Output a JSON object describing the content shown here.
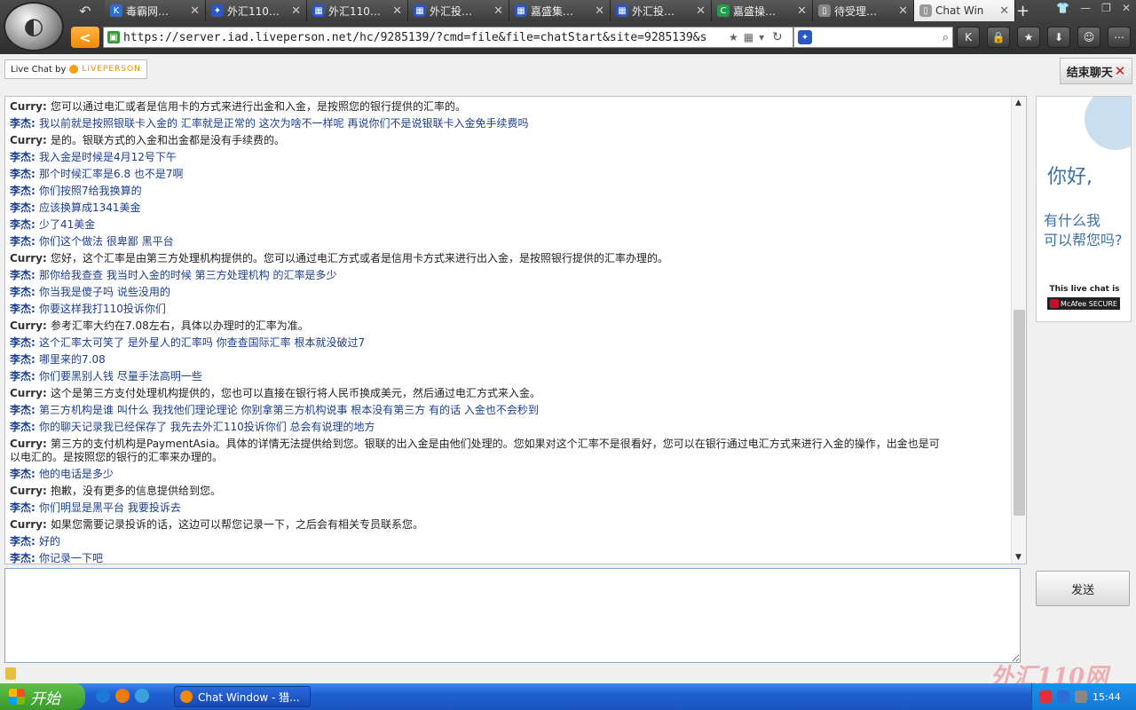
{
  "browser": {
    "tabs": [
      {
        "title": "毒霸网…",
        "icon_color": "#2b6fd6",
        "icon_glyph": "K",
        "active": false
      },
      {
        "title": "外汇110…",
        "icon_color": "#2b56c4",
        "icon_glyph": "✦",
        "active": false
      },
      {
        "title": "外汇110…",
        "icon_color": "#2b56c4",
        "icon_glyph": "▦",
        "active": false
      },
      {
        "title": "外汇投…",
        "icon_color": "#2b56c4",
        "icon_glyph": "▦",
        "active": false
      },
      {
        "title": "嘉盛集…",
        "icon_color": "#2b56c4",
        "icon_glyph": "▦",
        "active": false
      },
      {
        "title": "外汇投…",
        "icon_color": "#2b56c4",
        "icon_glyph": "▦",
        "active": false
      },
      {
        "title": "嘉盛操…",
        "icon_color": "#1e9e4a",
        "icon_glyph": "C",
        "active": false
      },
      {
        "title": "待受理…",
        "icon_color": "#888888",
        "icon_glyph": "▯",
        "active": false
      },
      {
        "title": "Chat Win",
        "icon_color": "#999999",
        "icon_glyph": "▯",
        "active": true
      }
    ],
    "url": "https://server.iad.liveperson.net/hc/9285139/?cmd=file&file=chatStart&site=9285139&s"
  },
  "page": {
    "logo_prefix": "Live Chat by",
    "logo_brand": "LIVEPERSON",
    "end_chat_label": "结束聊天",
    "send_label": "发送",
    "ad": {
      "hello": "你好,",
      "help_line1": "有什么我",
      "help_line2": "可以帮您吗?",
      "secure_text": "This live chat is",
      "mcafee_text": "McAfee SECURE"
    }
  },
  "messages": [
    {
      "who": "Curry",
      "role": "agent",
      "text": "您可以通过电汇或者是信用卡的方式来进行出金和入金，是按照您的银行提供的汇率的。"
    },
    {
      "who": "李杰",
      "role": "visitor",
      "text": "我以前就是按照银联卡入金的 汇率就是正常的 这次为啥不一样呢 再说你们不是说银联卡入金免手续费吗"
    },
    {
      "who": "Curry",
      "role": "agent",
      "text": "是的。银联方式的入金和出金都是没有手续费的。"
    },
    {
      "who": "李杰",
      "role": "visitor",
      "text": "我入金是时候是4月12号下午"
    },
    {
      "who": "李杰",
      "role": "visitor",
      "text": "那个时候汇率是6.8 也不是7啊"
    },
    {
      "who": "李杰",
      "role": "visitor",
      "text": "你们按照7给我换算的"
    },
    {
      "who": "李杰",
      "role": "visitor",
      "text": "应该换算成1341美金"
    },
    {
      "who": "李杰",
      "role": "visitor",
      "text": "少了41美金"
    },
    {
      "who": "李杰",
      "role": "visitor",
      "text": "你们这个做法 很卑鄙 黑平台"
    },
    {
      "who": "Curry",
      "role": "agent",
      "text": "您好，这个汇率是由第三方处理机构提供的。您可以通过电汇方式或者是信用卡方式来进行出入金，是按照银行提供的汇率办理的。"
    },
    {
      "who": "李杰",
      "role": "visitor",
      "text": "那你给我查查 我当时入金的时候 第三方处理机构 的汇率是多少"
    },
    {
      "who": "李杰",
      "role": "visitor",
      "text": "你当我是傻子吗 说些没用的"
    },
    {
      "who": "李杰",
      "role": "visitor",
      "text": "你要这样我打110投诉你们"
    },
    {
      "who": "Curry",
      "role": "agent",
      "text": "参考汇率大约在7.08左右，具体以办理时的汇率为准。"
    },
    {
      "who": "李杰",
      "role": "visitor",
      "text": "这个汇率太可笑了 是外星人的汇率吗 你查查国际汇率 根本就没破过7"
    },
    {
      "who": "李杰",
      "role": "visitor",
      "text": "哪里来的7.08"
    },
    {
      "who": "李杰",
      "role": "visitor",
      "text": "你们要黑别人钱 尽量手法高明一些"
    },
    {
      "who": "Curry",
      "role": "agent",
      "text": "这个是第三方支付处理机构提供的，您也可以直接在银行将人民币换成美元，然后通过电汇方式来入金。"
    },
    {
      "who": "李杰",
      "role": "visitor",
      "text": "第三方机构是谁 叫什么 我找他们理论理论 你别拿第三方机构说事 根本没有第三方 有的话 入金也不会秒到"
    },
    {
      "who": "李杰",
      "role": "visitor",
      "text": "你的聊天记录我已经保存了 我先去外汇110投诉你们 总会有说理的地方"
    },
    {
      "who": "Curry",
      "role": "agent",
      "wrap": true,
      "text": "第三方的支付机构是PaymentAsia。具体的详情无法提供给到您。银联的出入金是由他们处理的。您如果对这个汇率不是很看好，您可以在银行通过电汇方式来进行入金的操作，出金也是可以电汇的。是按照您的银行的汇率来办理的。"
    },
    {
      "who": "李杰",
      "role": "visitor",
      "text": "他的电话是多少"
    },
    {
      "who": "Curry",
      "role": "agent",
      "text": "抱歉，没有更多的信息提供给到您。"
    },
    {
      "who": "李杰",
      "role": "visitor",
      "text": "你们明显是黑平台 我要投诉去"
    },
    {
      "who": "Curry",
      "role": "agent",
      "text": "如果您需要记录投诉的话，这边可以帮您记录一下，之后会有相关专员联系您。"
    },
    {
      "who": "李杰",
      "role": "visitor",
      "text": "好的"
    },
    {
      "who": "李杰",
      "role": "visitor",
      "text": "你记录一下吧"
    }
  ],
  "taskbar": {
    "start_label": "开始",
    "task_label": "Chat Window - 猎...",
    "clock": "15:44"
  },
  "watermark": "外汇110网"
}
